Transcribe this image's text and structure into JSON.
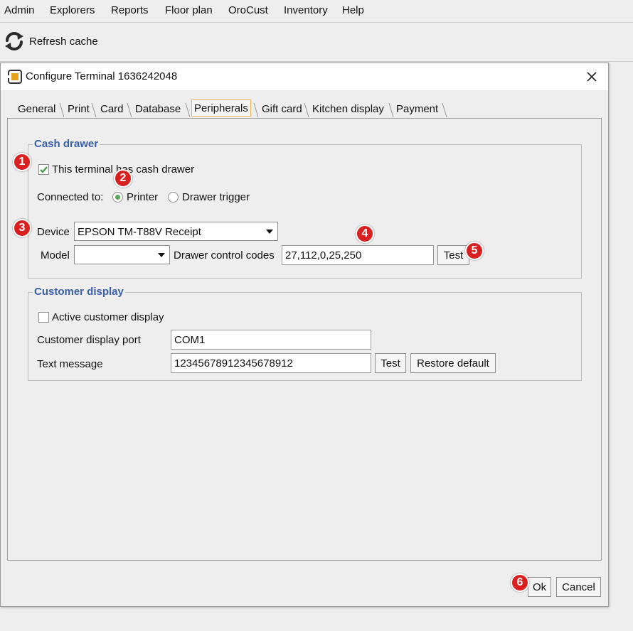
{
  "menubar": {
    "items": [
      "Admin",
      "Explorers",
      "Reports",
      "Floor plan",
      "OroCust",
      "Inventory",
      "Help"
    ]
  },
  "toolbar": {
    "refresh_label": "Refresh cache"
  },
  "dialog": {
    "title": "Configure Terminal 1636242048",
    "tabs": [
      "General",
      "Print",
      "Card",
      "Database",
      "Peripherals",
      "Gift card",
      "Kitchen display",
      "Payment"
    ],
    "selected_tab": "Peripherals"
  },
  "cash_drawer": {
    "title": "Cash drawer",
    "has_drawer_label": "This terminal has cash drawer",
    "has_drawer_checked": true,
    "connected_to_label": "Connected to:",
    "connected_options": [
      "Printer",
      "Drawer trigger"
    ],
    "connected_selected": "Printer",
    "device_label": "Device",
    "device_value": "EPSON TM-T88V Receipt",
    "model_label": "Model",
    "model_value": "",
    "codes_label": "Drawer control codes",
    "codes_value": "27,112,0,25,250",
    "test_label": "Test"
  },
  "customer_display": {
    "title": "Customer display",
    "active_label": "Active customer display",
    "active_checked": false,
    "port_label": "Customer display port",
    "port_value": "COM1",
    "message_label": "Text message",
    "message_value": "12345678912345678912",
    "test_label": "Test",
    "restore_label": "Restore default"
  },
  "footer": {
    "ok_label": "Ok",
    "cancel_label": "Cancel"
  },
  "annotations": [
    "1",
    "2",
    "3",
    "4",
    "5",
    "6"
  ],
  "colors": {
    "group_title": "#3a5fa8",
    "selected_tab_border": "#e8b35b",
    "badge": "#d91f1f",
    "check": "#3f9a3f"
  }
}
